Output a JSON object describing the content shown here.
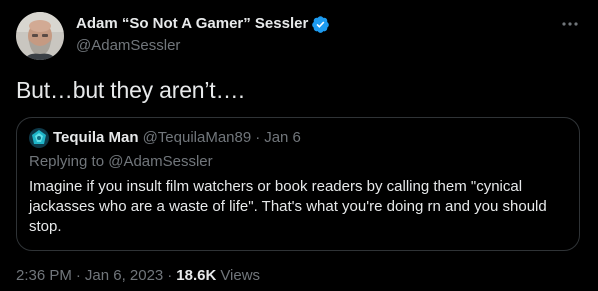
{
  "author": {
    "display_name": "Adam “So Not A Gamer” Sessler",
    "handle": "@AdamSessler",
    "verified": true,
    "verified_color": "#1d9bf0",
    "avatar_icon": "bald-bearded-man-avatar"
  },
  "tweet": {
    "text": "But…but they aren’t…."
  },
  "quoted": {
    "display_name": "Tequila Man",
    "handle": "@TequilaMan89",
    "separator": "·",
    "date": "Jan 6",
    "replying_prefix": "Replying to",
    "replying_handle": "@AdamSessler",
    "text": "Imagine if you insult film watchers or book readers by calling them \"cynical jackasses who are a waste of life\". That's what you're doing rn and you should stop.",
    "avatar_icon": "teal-blue-geometric-avatar"
  },
  "meta": {
    "time": "2:36 PM",
    "separator": "·",
    "date": "Jan 6, 2023",
    "views_count": "18.6K",
    "views_label": "Views"
  },
  "colors": {
    "background": "#000000",
    "text_primary": "#e7e9ea",
    "text_secondary": "#71767b",
    "border": "#2f3336"
  }
}
